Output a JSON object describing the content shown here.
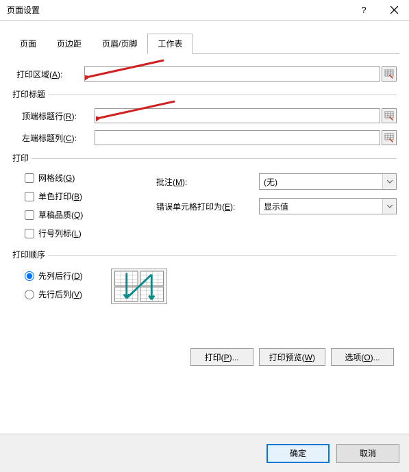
{
  "title": "页面设置",
  "tabs": {
    "page": "页面",
    "margins": "页边距",
    "headerfooter": "页眉/页脚",
    "sheet": "工作表"
  },
  "labels": {
    "print_area": "打印区域(A):",
    "print_titles": "打印标题",
    "top_rows": "顶端标题行(R):",
    "left_cols": "左端标题列(C):",
    "print_section": "打印",
    "gridlines": "网格线(G)",
    "monochrome": "单色打印(B)",
    "draft": "草稿品质(Q)",
    "rowcol_headings": "行号列标(L)",
    "comments": "批注(M):",
    "errors": "错误单元格打印为(E):",
    "order_section": "打印顺序",
    "down_then_over": "先列后行(D)",
    "over_then_down": "先行后列(V)"
  },
  "combos": {
    "comments_value": "(无)",
    "errors_value": "显示值"
  },
  "buttons": {
    "print": "打印(P)...",
    "preview": "打印预览(W)",
    "options": "选项(O)...",
    "ok": "确定",
    "cancel": "取消"
  }
}
